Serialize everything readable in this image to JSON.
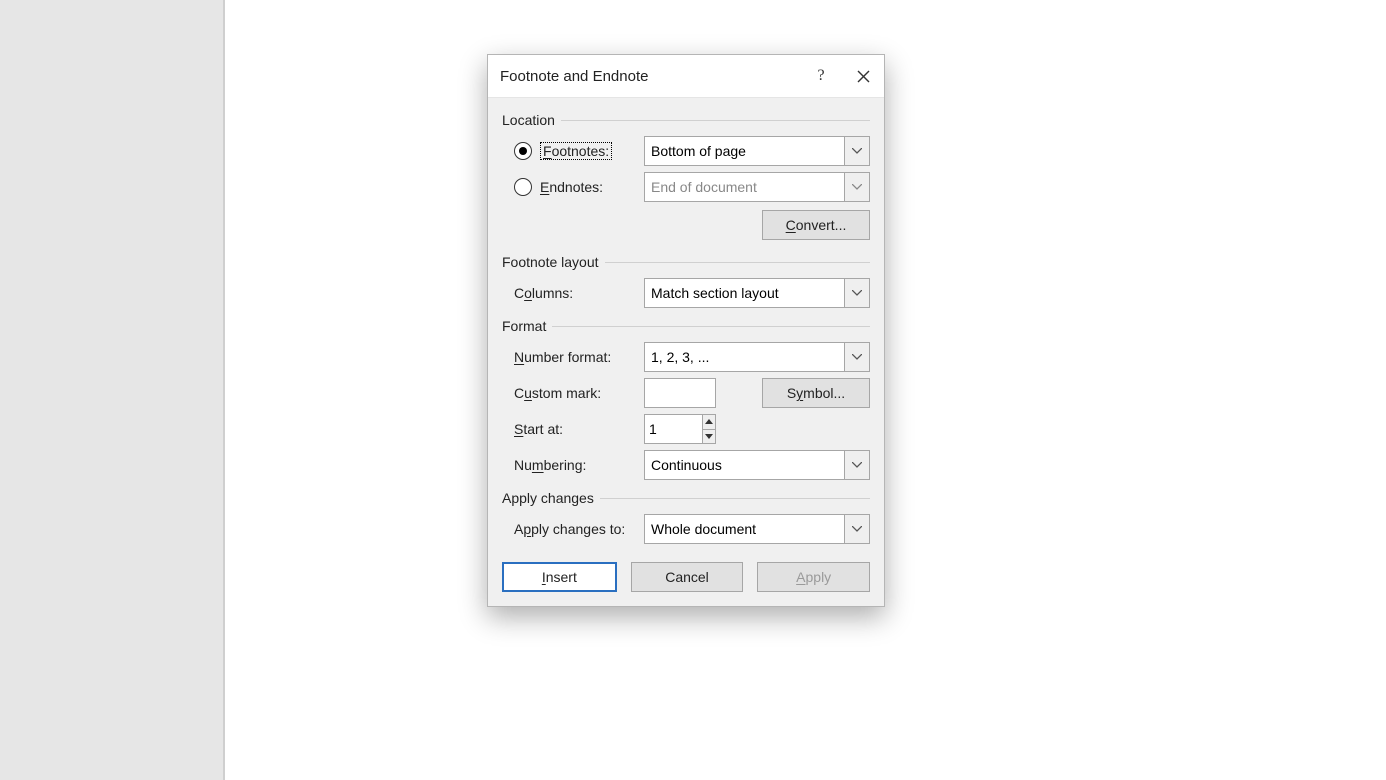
{
  "dialog": {
    "title": "Footnote and Endnote",
    "help": "?",
    "location": {
      "label": "Location",
      "footnotes": {
        "label": "Footnotes:",
        "value": "Bottom of page",
        "selected": true
      },
      "endnotes": {
        "label": "Endnotes:",
        "value": "End of document",
        "selected": false
      },
      "convert": "Convert..."
    },
    "footnote_layout": {
      "label": "Footnote layout",
      "columns_label": "Columns:",
      "columns_value": "Match section layout"
    },
    "format": {
      "label": "Format",
      "number_format_label": "Number format:",
      "number_format_value": "1, 2, 3, ...",
      "custom_mark_label": "Custom mark:",
      "custom_mark_value": "",
      "symbol_button": "Symbol...",
      "start_at_label": "Start at:",
      "start_at_value": "1",
      "numbering_label": "Numbering:",
      "numbering_value": "Continuous"
    },
    "apply_changes": {
      "label": "Apply changes",
      "to_label": "Apply changes to:",
      "to_value": "Whole document"
    },
    "buttons": {
      "insert": "Insert",
      "cancel": "Cancel",
      "apply": "Apply"
    }
  }
}
